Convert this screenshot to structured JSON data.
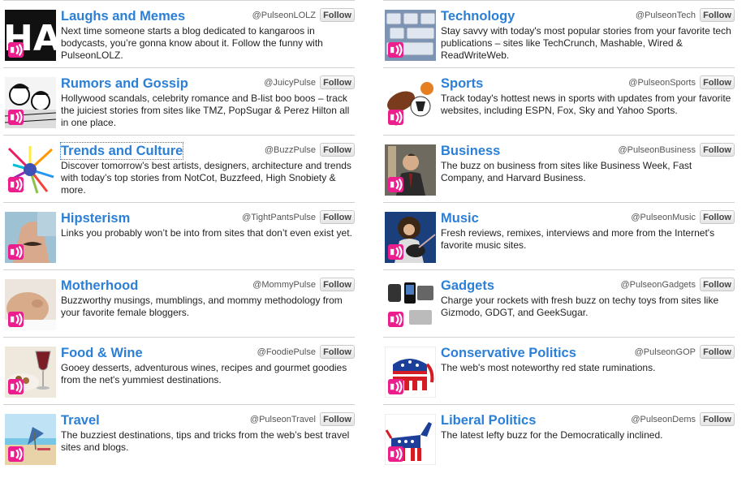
{
  "follow_label": "Follow",
  "accent": "#2b7fd6",
  "badge_color": "#ec1d8d",
  "left_column": [
    {
      "title": "Laughs and Memes",
      "handle": "@PulseonLOLZ",
      "description": "Next time someone starts a blog dedicated to kangaroos in bodycasts, you’re gonna know about it. Follow the funny with PulseonLOLZ.",
      "thumb_icon": "ha-text-image",
      "thumb_text": "HA"
    },
    {
      "title": "Rumors and Gossip",
      "handle": "@JuicyPulse",
      "description": "Hollywood scandals, celebrity romance and B-list boo boos – track the juiciest stories from sites like TMZ, PopSugar & Perez Hilton all in one place.",
      "thumb_icon": "comic-gossip-image"
    },
    {
      "title": "Trends and Culture",
      "handle": "@BuzzPulse",
      "description": "Discover tomorrow’s best artists, designers, architecture and trends with today’s top stories from NotCot, Buzzfeed, High Snobiety & more.",
      "thumb_icon": "colorful-burst-image"
    },
    {
      "title": "Hipsterism",
      "handle": "@TightPantsPulse",
      "description": "Links you probably won’t be into from sites that don’t even exist yet.",
      "thumb_icon": "mustache-face-image"
    },
    {
      "title": "Motherhood",
      "handle": "@MommyPulse",
      "description": "Buzzworthy musings, mumblings, and mommy methodology from your favorite female bloggers.",
      "thumb_icon": "pregnant-belly-image"
    },
    {
      "title": "Food & Wine",
      "handle": "@FoodiePulse",
      "description": "Gooey desserts, adventurous wines, recipes and gourmet goodies from the net's yummiest destinations.",
      "thumb_icon": "wine-glass-image"
    },
    {
      "title": "Travel",
      "handle": "@PulseonTravel",
      "description": "The buzziest destinations, tips and tricks from the web’s best travel sites and blogs.",
      "thumb_icon": "beach-image"
    }
  ],
  "right_column": [
    {
      "title": "Technology",
      "handle": "@PulseonTech",
      "description": "Stay savvy with today's most popular stories from your favorite tech publications – sites like TechCrunch, Mashable, Wired & ReadWriteWeb.",
      "thumb_icon": "keyboard-image"
    },
    {
      "title": "Sports",
      "handle": "@PulseonSports",
      "description": "Track today's hottest news in sports with updates from your favorite websites, including ESPN, Fox, Sky and Yahoo Sports.",
      "thumb_icon": "sports-balls-image"
    },
    {
      "title": "Business",
      "handle": "@PulseonBusiness",
      "description": "The buzz on business from sites like Business Week, Fast Company, and Harvard Business.",
      "thumb_icon": "businessman-image"
    },
    {
      "title": "Music",
      "handle": "@PulseonMusic",
      "description": "Fresh reviews, remixes, interviews and more from the Internet's favorite music sites.",
      "thumb_icon": "guitarist-image"
    },
    {
      "title": "Gadgets",
      "handle": "@PulseonGadgets",
      "description": "Charge your rockets with fresh buzz on techy toys from sites like Gizmodo, GDGT, and GeekSugar.",
      "thumb_icon": "gadgets-image"
    },
    {
      "title": "Conservative Politics",
      "handle": "@PulseonGOP",
      "description": "The web's most noteworthy red state ruminations.",
      "thumb_icon": "republican-elephant-image"
    },
    {
      "title": "Liberal Politics",
      "handle": "@PulseonDems",
      "description": "The latest lefty buzz for the Democratically inclined.",
      "thumb_icon": "democrat-donkey-image"
    }
  ]
}
